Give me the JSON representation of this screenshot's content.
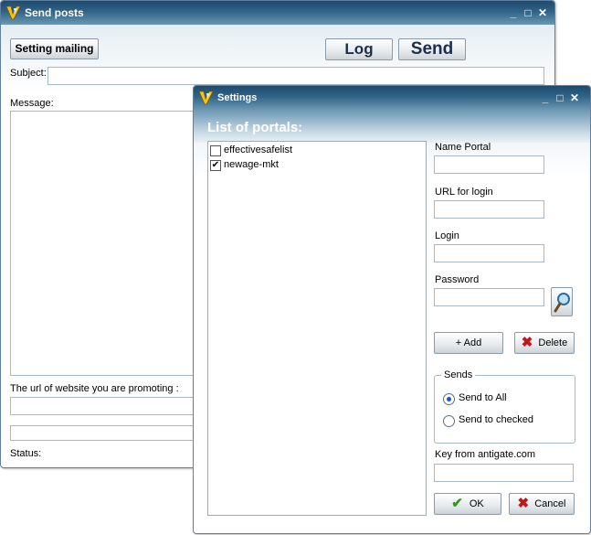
{
  "send_posts": {
    "title": "Send posts",
    "setting_mailing_label": "Setting mailing",
    "log_label": "Log",
    "send_label": "Send",
    "subject_label": "Subject:",
    "message_label": "Message:",
    "url_label": "The url of website you are promoting :",
    "status_label": "Status:"
  },
  "settings": {
    "title": "Settings",
    "list_heading": "List of portals:",
    "portals": [
      {
        "name": "effectivesafelist",
        "checked": false
      },
      {
        "name": "newage-mkt",
        "checked": true
      }
    ],
    "name_portal_label": "Name Portal",
    "url_login_label": "URL for login",
    "login_label": "Login",
    "password_label": "Password",
    "add_label": "+ Add",
    "delete_label": "Delete",
    "sends_group_label": "Sends",
    "send_to_all_label": "Send to All",
    "send_to_checked_label": "Send to checked",
    "send_mode_selected": "Send to All",
    "antigate_label": "Key from antigate.com",
    "ok_label": "OK",
    "cancel_label": "Cancel"
  },
  "colors": {
    "titlebar_top": "#1e4a6c",
    "titlebar_bottom": "#6c97b2",
    "heading_text": "#ffffff",
    "delete_red": "#c0171c",
    "ok_green": "#2e9a1c"
  },
  "icons": [
    "app-logo-icon",
    "minimize-icon",
    "maximize-icon",
    "close-icon",
    "magnifier-icon",
    "delete-x-icon",
    "checkmark-icon",
    "cancel-x-icon"
  ]
}
